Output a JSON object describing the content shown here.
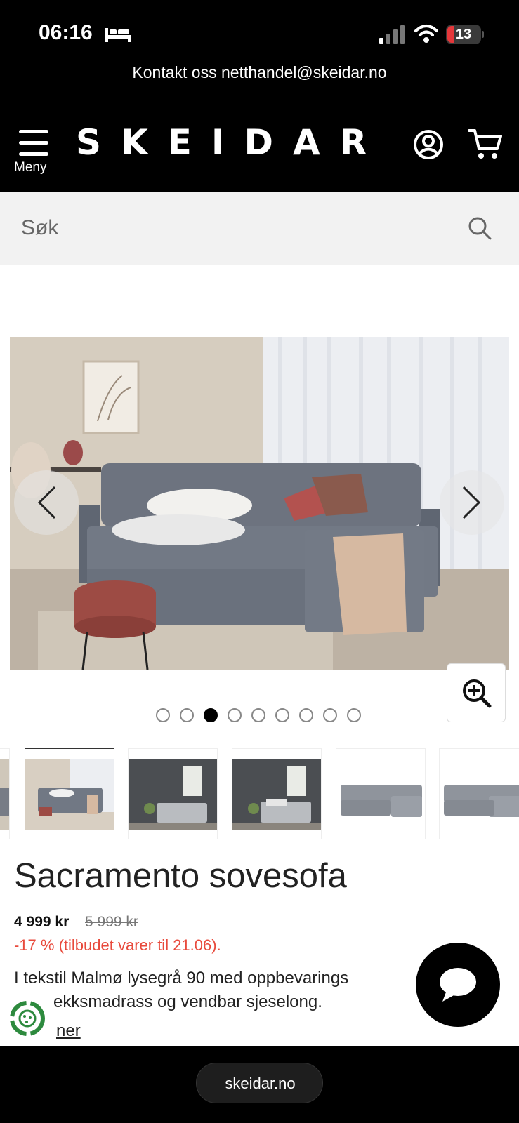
{
  "status_bar": {
    "time": "06:16",
    "battery": "13"
  },
  "contact": {
    "text": "Kontakt oss netthandel@skeidar.no"
  },
  "header": {
    "menu_label": "Meny",
    "logo": "SKEIDAR"
  },
  "search": {
    "placeholder": "Søk"
  },
  "carousel": {
    "dot_count": 9,
    "active_index": 2
  },
  "product": {
    "title": "Sacramento sovesofa",
    "price": "4 999 kr",
    "old_price": "5 999 kr",
    "discount": "-17 % (tilbudet varer til 21.06).",
    "description_line1": "I tekstil Malmø lysegrå 90 med oppbevarings",
    "description_line2": "ekksmadrass og vendbar sjeselong.",
    "more_link": "ner"
  },
  "browser": {
    "url": "skeidar.no"
  },
  "colors": {
    "accent_red": "#e84a3c",
    "header_bg": "#000000",
    "search_bg": "#f2f2f2"
  }
}
